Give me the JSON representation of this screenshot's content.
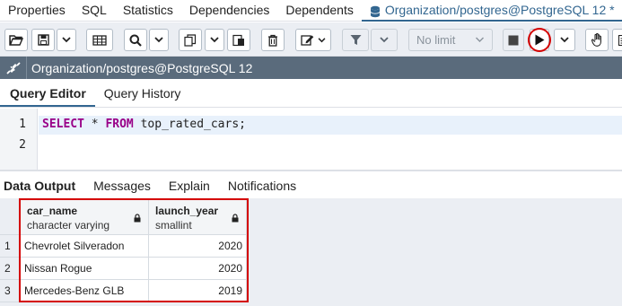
{
  "tabs": [
    {
      "label": "Properties"
    },
    {
      "label": "SQL"
    },
    {
      "label": "Statistics"
    },
    {
      "label": "Dependencies"
    },
    {
      "label": "Dependents"
    },
    {
      "label": "Organization/postgres@PostgreSQL 12 *",
      "icon": "database-icon"
    }
  ],
  "toolbar": {
    "limit_label": "No limit",
    "icons": [
      "folder-open-icon",
      "save-icon",
      "chevron-down-icon",
      "grid-icon",
      "search-icon",
      "chevron-down-icon",
      "copy-icon",
      "chevron-down-icon",
      "paste-icon",
      "trash-icon",
      "edit-icon",
      "filter-icon",
      "chevron-down-icon",
      "stop-icon",
      "play-icon",
      "chevron-down-icon",
      "hand-icon",
      "list-icon"
    ]
  },
  "connection": {
    "label": "Organization/postgres@PostgreSQL 12",
    "icon": "plug-icon"
  },
  "editor_tabs": [
    {
      "label": "Query Editor"
    },
    {
      "label": "Query History"
    }
  ],
  "editor": {
    "line_numbers": [
      "1",
      "2"
    ],
    "code": {
      "kw1": "SELECT",
      "op": " * ",
      "kw2": "FROM",
      "rest": " top_rated_cars;"
    }
  },
  "result_tabs": [
    {
      "label": "Data Output"
    },
    {
      "label": "Messages"
    },
    {
      "label": "Explain"
    },
    {
      "label": "Notifications"
    }
  ],
  "grid": {
    "columns": [
      {
        "name": "car_name",
        "type": "character varying"
      },
      {
        "name": "launch_year",
        "type": "smallint"
      }
    ],
    "rows": [
      {
        "num": "1",
        "car_name": "Chevrolet Silveradon",
        "launch_year": "2020"
      },
      {
        "num": "2",
        "car_name": "Nissan Rogue",
        "launch_year": "2020"
      },
      {
        "num": "3",
        "car_name": "Mercedes-Benz GLB",
        "launch_year": "2019"
      }
    ]
  },
  "colors": {
    "accent": "#326690",
    "highlight_red": "#d40000",
    "connection_bar": "#5a6b7c",
    "keyword": "#990088"
  }
}
